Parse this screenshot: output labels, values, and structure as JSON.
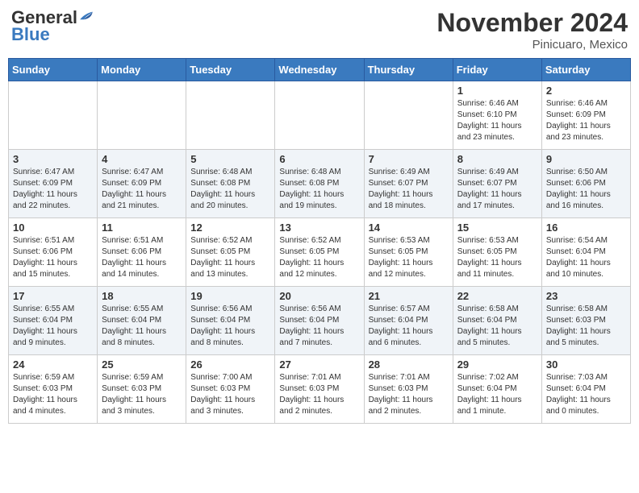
{
  "header": {
    "logo": {
      "line1": "General",
      "line2": "Blue"
    },
    "month_title": "November 2024",
    "subtitle": "Pinicuaro, Mexico"
  },
  "weekdays": [
    "Sunday",
    "Monday",
    "Tuesday",
    "Wednesday",
    "Thursday",
    "Friday",
    "Saturday"
  ],
  "weeks": [
    [
      {
        "day": "",
        "info": ""
      },
      {
        "day": "",
        "info": ""
      },
      {
        "day": "",
        "info": ""
      },
      {
        "day": "",
        "info": ""
      },
      {
        "day": "",
        "info": ""
      },
      {
        "day": "1",
        "info": "Sunrise: 6:46 AM\nSunset: 6:10 PM\nDaylight: 11 hours and 23 minutes."
      },
      {
        "day": "2",
        "info": "Sunrise: 6:46 AM\nSunset: 6:09 PM\nDaylight: 11 hours and 23 minutes."
      }
    ],
    [
      {
        "day": "3",
        "info": "Sunrise: 6:47 AM\nSunset: 6:09 PM\nDaylight: 11 hours and 22 minutes."
      },
      {
        "day": "4",
        "info": "Sunrise: 6:47 AM\nSunset: 6:09 PM\nDaylight: 11 hours and 21 minutes."
      },
      {
        "day": "5",
        "info": "Sunrise: 6:48 AM\nSunset: 6:08 PM\nDaylight: 11 hours and 20 minutes."
      },
      {
        "day": "6",
        "info": "Sunrise: 6:48 AM\nSunset: 6:08 PM\nDaylight: 11 hours and 19 minutes."
      },
      {
        "day": "7",
        "info": "Sunrise: 6:49 AM\nSunset: 6:07 PM\nDaylight: 11 hours and 18 minutes."
      },
      {
        "day": "8",
        "info": "Sunrise: 6:49 AM\nSunset: 6:07 PM\nDaylight: 11 hours and 17 minutes."
      },
      {
        "day": "9",
        "info": "Sunrise: 6:50 AM\nSunset: 6:06 PM\nDaylight: 11 hours and 16 minutes."
      }
    ],
    [
      {
        "day": "10",
        "info": "Sunrise: 6:51 AM\nSunset: 6:06 PM\nDaylight: 11 hours and 15 minutes."
      },
      {
        "day": "11",
        "info": "Sunrise: 6:51 AM\nSunset: 6:06 PM\nDaylight: 11 hours and 14 minutes."
      },
      {
        "day": "12",
        "info": "Sunrise: 6:52 AM\nSunset: 6:05 PM\nDaylight: 11 hours and 13 minutes."
      },
      {
        "day": "13",
        "info": "Sunrise: 6:52 AM\nSunset: 6:05 PM\nDaylight: 11 hours and 12 minutes."
      },
      {
        "day": "14",
        "info": "Sunrise: 6:53 AM\nSunset: 6:05 PM\nDaylight: 11 hours and 12 minutes."
      },
      {
        "day": "15",
        "info": "Sunrise: 6:53 AM\nSunset: 6:05 PM\nDaylight: 11 hours and 11 minutes."
      },
      {
        "day": "16",
        "info": "Sunrise: 6:54 AM\nSunset: 6:04 PM\nDaylight: 11 hours and 10 minutes."
      }
    ],
    [
      {
        "day": "17",
        "info": "Sunrise: 6:55 AM\nSunset: 6:04 PM\nDaylight: 11 hours and 9 minutes."
      },
      {
        "day": "18",
        "info": "Sunrise: 6:55 AM\nSunset: 6:04 PM\nDaylight: 11 hours and 8 minutes."
      },
      {
        "day": "19",
        "info": "Sunrise: 6:56 AM\nSunset: 6:04 PM\nDaylight: 11 hours and 8 minutes."
      },
      {
        "day": "20",
        "info": "Sunrise: 6:56 AM\nSunset: 6:04 PM\nDaylight: 11 hours and 7 minutes."
      },
      {
        "day": "21",
        "info": "Sunrise: 6:57 AM\nSunset: 6:04 PM\nDaylight: 11 hours and 6 minutes."
      },
      {
        "day": "22",
        "info": "Sunrise: 6:58 AM\nSunset: 6:04 PM\nDaylight: 11 hours and 5 minutes."
      },
      {
        "day": "23",
        "info": "Sunrise: 6:58 AM\nSunset: 6:03 PM\nDaylight: 11 hours and 5 minutes."
      }
    ],
    [
      {
        "day": "24",
        "info": "Sunrise: 6:59 AM\nSunset: 6:03 PM\nDaylight: 11 hours and 4 minutes."
      },
      {
        "day": "25",
        "info": "Sunrise: 6:59 AM\nSunset: 6:03 PM\nDaylight: 11 hours and 3 minutes."
      },
      {
        "day": "26",
        "info": "Sunrise: 7:00 AM\nSunset: 6:03 PM\nDaylight: 11 hours and 3 minutes."
      },
      {
        "day": "27",
        "info": "Sunrise: 7:01 AM\nSunset: 6:03 PM\nDaylight: 11 hours and 2 minutes."
      },
      {
        "day": "28",
        "info": "Sunrise: 7:01 AM\nSunset: 6:03 PM\nDaylight: 11 hours and 2 minutes."
      },
      {
        "day": "29",
        "info": "Sunrise: 7:02 AM\nSunset: 6:04 PM\nDaylight: 11 hours and 1 minute."
      },
      {
        "day": "30",
        "info": "Sunrise: 7:03 AM\nSunset: 6:04 PM\nDaylight: 11 hours and 0 minutes."
      }
    ]
  ]
}
